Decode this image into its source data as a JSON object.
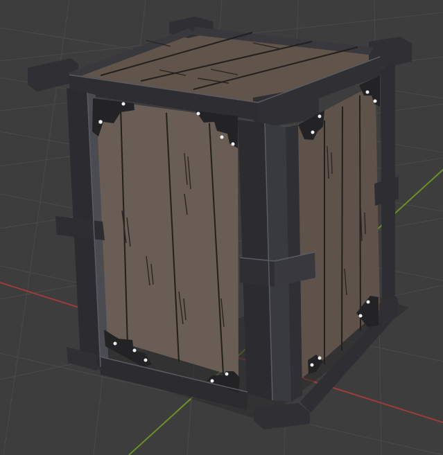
{
  "viewport": {
    "background_color": "#3d3d3d",
    "grid_color": "#4a4a4a",
    "x_axis_color": "#9e3b3b",
    "y_axis_color": "#6d8f27"
  },
  "crate": {
    "frame_color": "#2f2f34",
    "frame_highlight": "#55555c",
    "wood_front_color": "#6a5d55",
    "wood_side_color": "#5e524b",
    "wood_top_color": "#61544b",
    "plank_line_color": "#231f1d",
    "bracket_color": "#232326",
    "rivet_color": "#f2f2f2"
  }
}
